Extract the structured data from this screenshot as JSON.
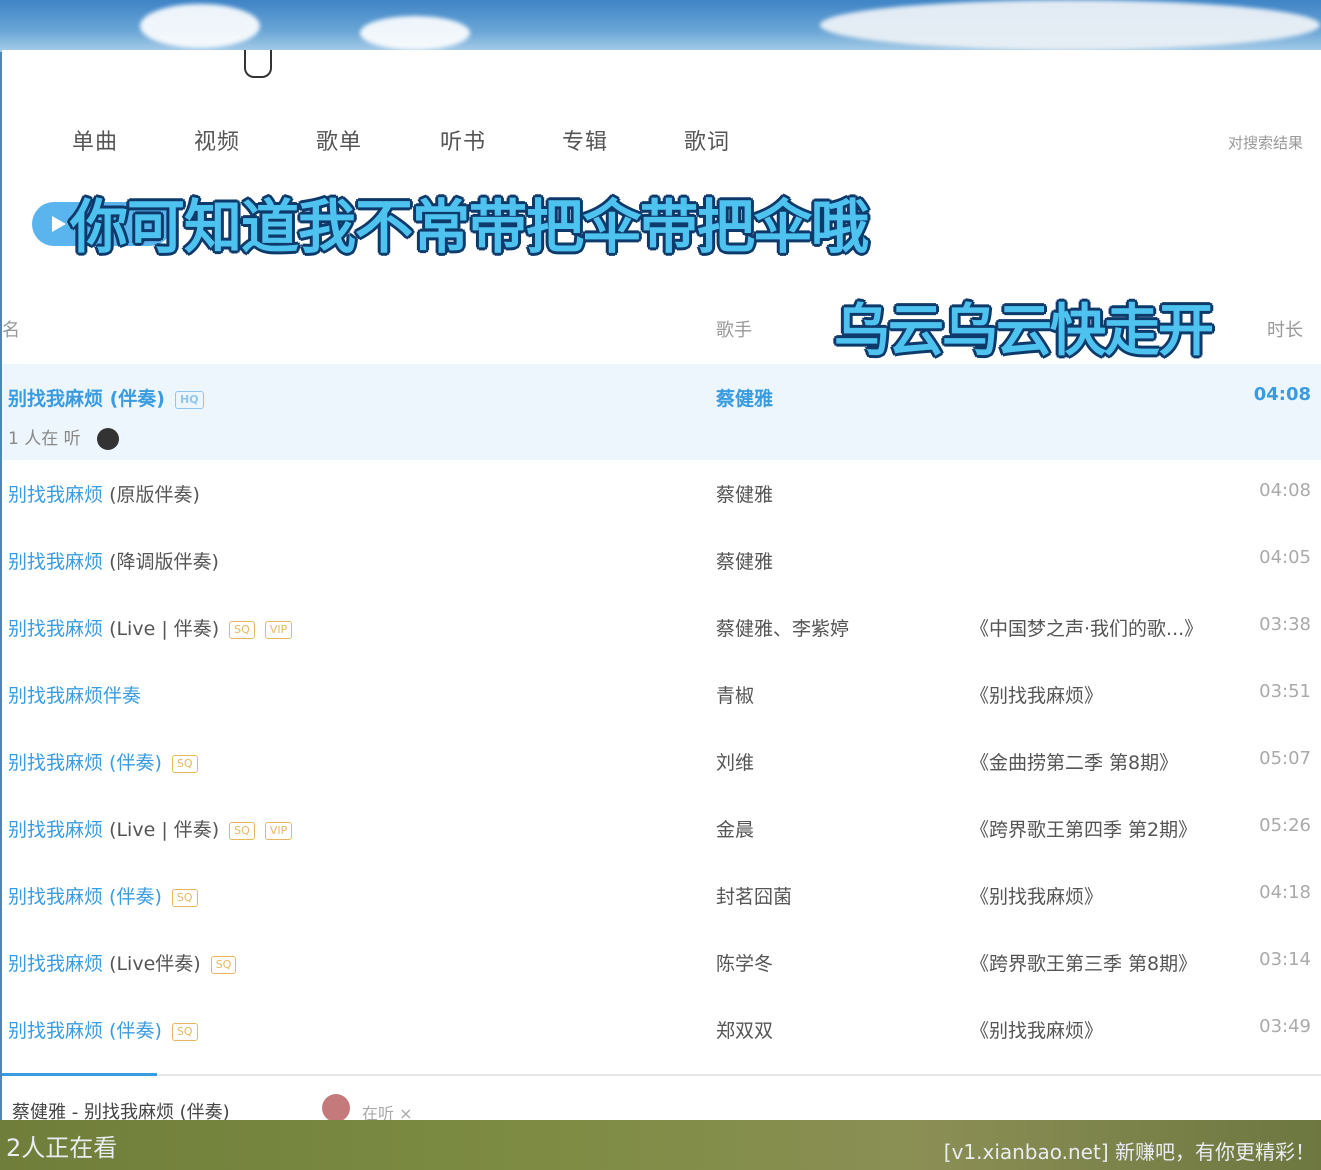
{
  "tabs": [
    "单曲",
    "视频",
    "歌单",
    "听书",
    "专辑",
    "歌词"
  ],
  "tabs_right": "对搜索结果",
  "lyrics": {
    "line1": "你可知道我不常带把伞带把伞哦",
    "line2": "乌云乌云快走开"
  },
  "columns": {
    "title": "名",
    "singer": "歌手",
    "duration": "时长"
  },
  "songs": [
    {
      "title": "别找我麻烦 (伴奏)",
      "badge": "HQ",
      "singer": "蔡健雅",
      "album": "",
      "duration": "04:08",
      "listeners": "1 人在 听"
    },
    {
      "title": "别找我麻烦",
      "title_plain": "(原版伴奏)",
      "singer": "蔡健雅",
      "album": "",
      "duration": "04:08"
    },
    {
      "title": "别找我麻烦",
      "title_plain": "(降调版伴奏)",
      "singer": "蔡健雅",
      "album": "",
      "duration": "04:05"
    },
    {
      "title": "别找我麻烦",
      "title_plain": "(Live | 伴奏)",
      "badge": "SQ",
      "badge2": "VIP",
      "singer": "蔡健雅、李紫婷",
      "album": "《中国梦之声·我们的歌...》",
      "duration": "03:38"
    },
    {
      "title": "别找我麻烦伴奏",
      "singer": "青椒",
      "album": "《别找我麻烦》",
      "duration": "03:51"
    },
    {
      "title": "别找我麻烦 (伴奏)",
      "badge": "SQ",
      "singer": "刘维",
      "album": "《金曲捞第二季 第8期》",
      "duration": "05:07"
    },
    {
      "title": "别找我麻烦",
      "title_plain": "(Live | 伴奏)",
      "badge": "SQ",
      "badge2": "VIP",
      "singer": "金晨",
      "album": "《跨界歌王第四季 第2期》",
      "duration": "05:26"
    },
    {
      "title": "别找我麻烦 (伴奏)",
      "badge": "SQ",
      "singer": "封茗囧菌",
      "album": "《别找我麻烦》",
      "duration": "04:18"
    },
    {
      "title": "别找我麻烦",
      "title_plain": "(Live伴奏)",
      "badge": "SQ",
      "singer": "陈学冬",
      "album": "《跨界歌王第三季 第8期》",
      "duration": "03:14"
    },
    {
      "title": "别找我麻烦 (伴奏)",
      "badge": "SQ",
      "singer": "郑双双",
      "album": "《别找我麻烦》",
      "duration": "03:49"
    }
  ],
  "now_playing": "蔡健雅 - 别找我麻烦 (伴奏)",
  "now_playing_extra": "在听 ×",
  "viewers": "2人正在看",
  "watermark": "[v1.xianbao.net] 新赚吧，有你更精彩！"
}
